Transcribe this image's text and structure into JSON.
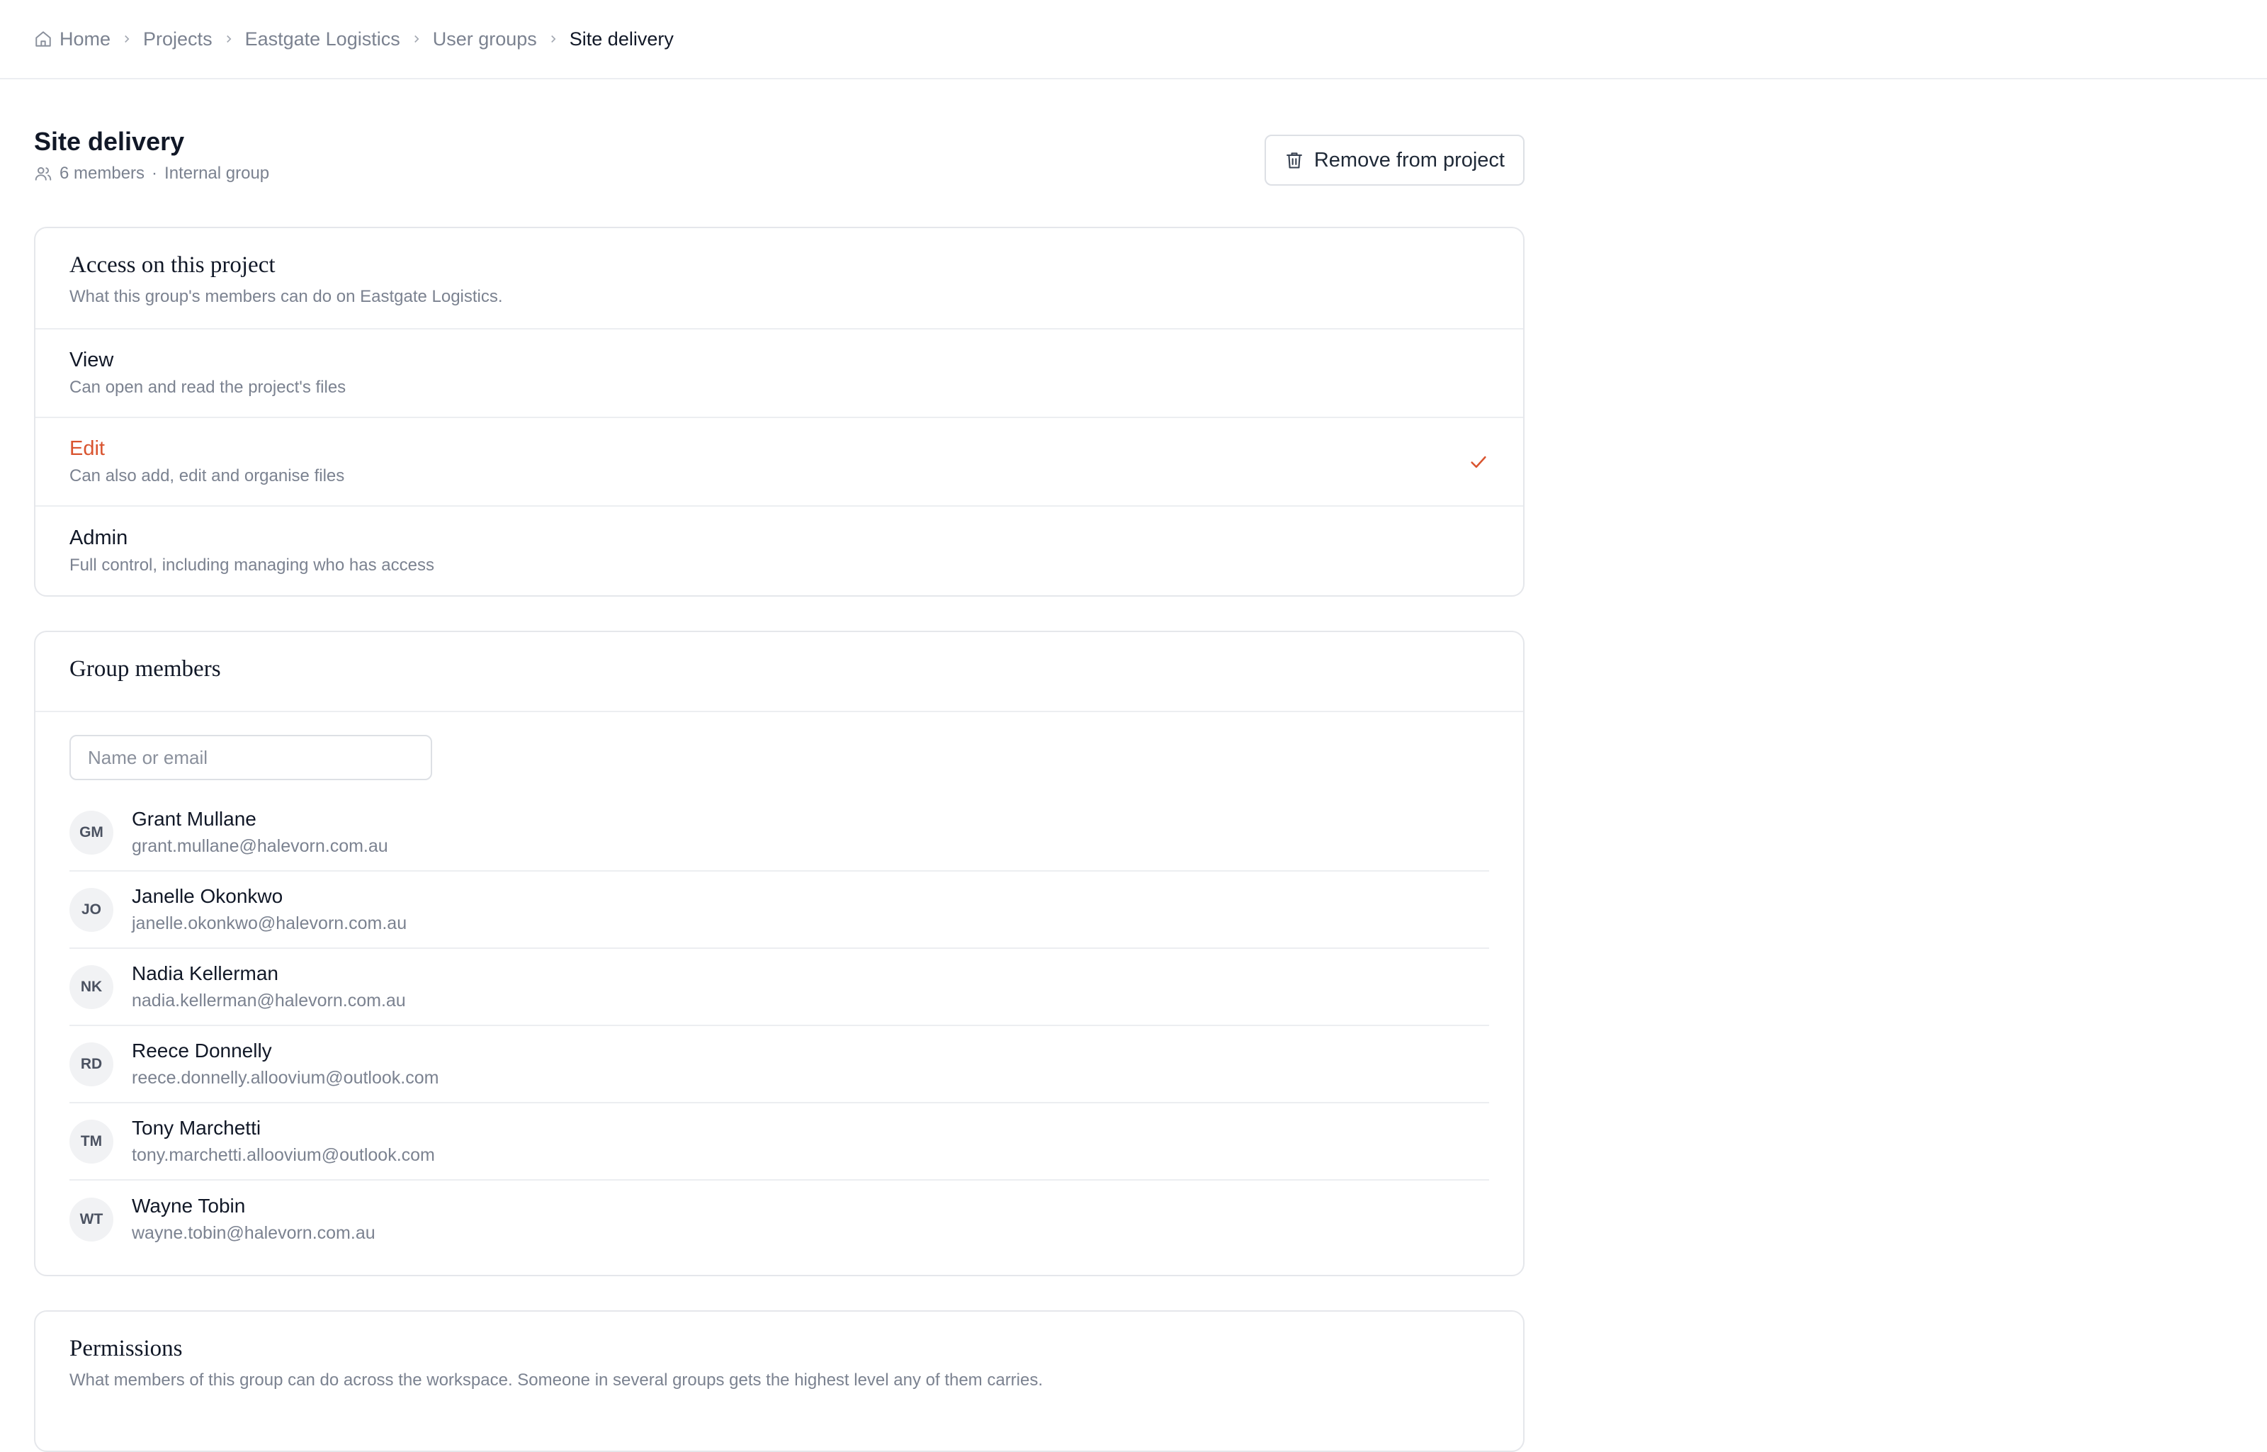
{
  "breadcrumb": {
    "items": [
      "Home",
      "Projects",
      "Eastgate Logistics",
      "User groups"
    ],
    "current": "Site delivery"
  },
  "header": {
    "title": "Site delivery",
    "members_count": "6 members",
    "separator": "·",
    "group_type": "Internal group",
    "remove_label": "Remove from project"
  },
  "access": {
    "title": "Access on this project",
    "subtitle": "What this group's members can do on Eastgate Logistics.",
    "selected": "Edit",
    "options": [
      {
        "label": "View",
        "desc": "Can open and read the project's files"
      },
      {
        "label": "Edit",
        "desc": "Can also add, edit and organise files"
      },
      {
        "label": "Admin",
        "desc": "Full control, including managing who has access"
      }
    ]
  },
  "members": {
    "title": "Group members",
    "search_placeholder": "Name or email",
    "list": [
      {
        "initials": "GM",
        "name": "Grant Mullane",
        "email": "grant.mullane@halevorn.com.au"
      },
      {
        "initials": "JO",
        "name": "Janelle Okonkwo",
        "email": "janelle.okonkwo@halevorn.com.au"
      },
      {
        "initials": "NK",
        "name": "Nadia Kellerman",
        "email": "nadia.kellerman@halevorn.com.au"
      },
      {
        "initials": "RD",
        "name": "Reece Donnelly",
        "email": "reece.donnelly.alloovium@outlook.com"
      },
      {
        "initials": "TM",
        "name": "Tony Marchetti",
        "email": "tony.marchetti.alloovium@outlook.com"
      },
      {
        "initials": "WT",
        "name": "Wayne Tobin",
        "email": "wayne.tobin@halevorn.com.au"
      }
    ]
  },
  "permissions": {
    "title": "Permissions",
    "subtitle": "What members of this group can do across the workspace. Someone in several groups gets the highest level any of them carries."
  },
  "colors": {
    "accent": "#d9542f",
    "muted_text": "#7b8290",
    "border": "#e5e7eb"
  },
  "icons": {
    "home": "home-icon",
    "chevron": "chevron-right-icon",
    "users": "users-icon",
    "trash": "trash-icon",
    "check": "check-icon"
  }
}
